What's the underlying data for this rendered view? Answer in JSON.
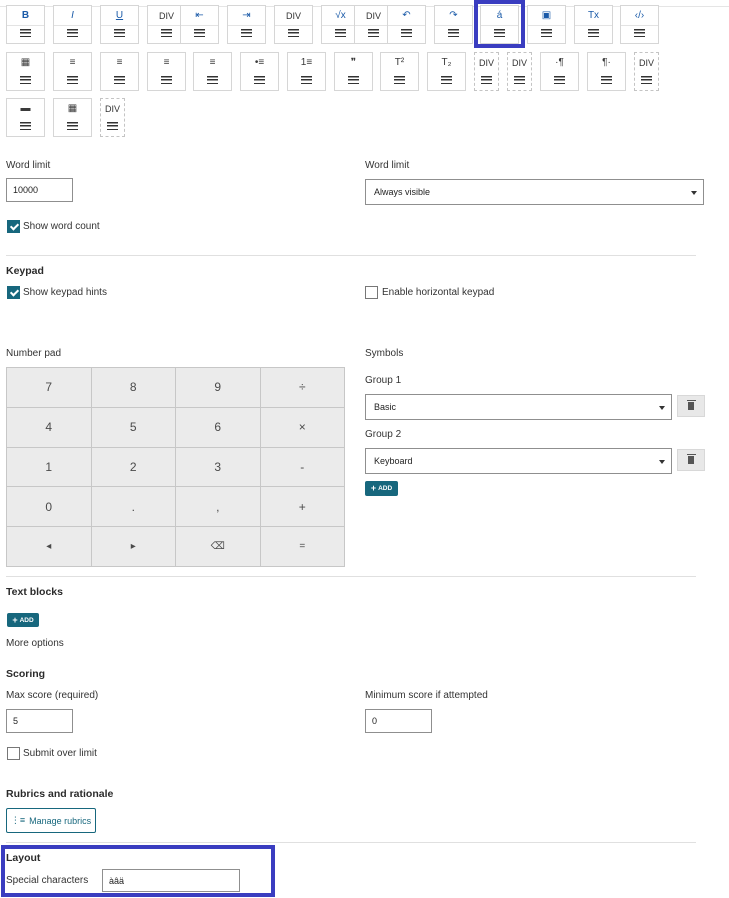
{
  "toolbar": {
    "row1": [
      {
        "icon": "B",
        "name": "bold-icon",
        "type": "std"
      },
      {
        "icon": "I",
        "name": "italic-icon",
        "type": "std"
      },
      {
        "icon": "U",
        "name": "underline-icon",
        "type": "std"
      },
      {
        "icon": "DIV",
        "name": "div-icon",
        "type": "std"
      },
      {
        "icon": "⇤",
        "name": "outdent-icon",
        "type": "std"
      },
      {
        "icon": "⇥",
        "name": "indent-icon",
        "type": "std"
      },
      {
        "icon": "DIV",
        "name": "div-icon",
        "type": "std"
      },
      {
        "icon": "√x",
        "name": "math-icon",
        "type": "std"
      },
      {
        "icon": "DIV",
        "name": "div-icon",
        "type": "std"
      },
      {
        "icon": "↶",
        "name": "undo-icon",
        "type": "std"
      },
      {
        "icon": "↷",
        "name": "redo-icon",
        "type": "std"
      },
      {
        "icon": "á",
        "name": "special-characters-icon",
        "type": "std"
      },
      {
        "icon": "▣",
        "name": "image-icon",
        "type": "std"
      },
      {
        "icon": "Tx",
        "name": "clear-format-icon",
        "type": "std"
      },
      {
        "icon": "‹/›",
        "name": "source-code-icon",
        "type": "std"
      }
    ],
    "row2": [
      {
        "icon": "▦",
        "name": "calendar-icon",
        "type": "plain"
      },
      {
        "icon": "≡",
        "name": "align-left-icon",
        "type": "plain"
      },
      {
        "icon": "≡",
        "name": "align-center-icon",
        "type": "plain"
      },
      {
        "icon": "≡",
        "name": "align-right-icon",
        "type": "plain"
      },
      {
        "icon": "≡",
        "name": "justify-icon",
        "type": "plain"
      },
      {
        "icon": "•≡",
        "name": "bulleted-list-icon",
        "type": "plain"
      },
      {
        "icon": "1≡",
        "name": "numbered-list-icon",
        "type": "plain"
      },
      {
        "icon": "❞",
        "name": "blockquote-icon",
        "type": "plain"
      },
      {
        "icon": "T²",
        "name": "superscript-icon",
        "type": "plain"
      },
      {
        "icon": "T₂",
        "name": "subscript-icon",
        "type": "plain"
      },
      {
        "icon": "DIV",
        "name": "div-icon",
        "type": "dashed"
      },
      {
        "icon": "DIV",
        "name": "div-icon",
        "type": "dashed"
      },
      {
        "icon": "·¶",
        "name": "ltr-paragraph-icon",
        "type": "plain"
      },
      {
        "icon": "¶·",
        "name": "rtl-paragraph-icon",
        "type": "plain"
      },
      {
        "icon": "DIV",
        "name": "div-icon",
        "type": "dashed"
      }
    ],
    "row3": [
      {
        "icon": "▬",
        "name": "horizontal-rule-icon",
        "type": "plain"
      },
      {
        "icon": "▦",
        "name": "table-icon",
        "type": "plain"
      },
      {
        "icon": "DIV",
        "name": "div-icon",
        "type": "dashed"
      }
    ]
  },
  "word_limit": {
    "label": "Word limit",
    "value": "10000",
    "mode_label": "Word limit",
    "mode_value": "Always visible",
    "show_count_label": "Show word count"
  },
  "keypad": {
    "heading": "Keypad",
    "show_hints_label": "Show keypad hints",
    "horizontal_label": "Enable horizontal keypad",
    "number_pad_label": "Number pad",
    "keys": [
      "7",
      "8",
      "9",
      "÷",
      "4",
      "5",
      "6",
      "×",
      "1",
      "2",
      "3",
      "-",
      "0",
      ".",
      ",",
      "+",
      "◂",
      "▸",
      "⌫",
      "="
    ],
    "symbols_label": "Symbols",
    "group1_label": "Group 1",
    "group1_value": "Basic",
    "group2_label": "Group 2",
    "group2_value": "Keyboard",
    "add_label": "ADD"
  },
  "text_blocks": {
    "heading": "Text blocks",
    "add_label": "ADD"
  },
  "more_options": "More options",
  "scoring": {
    "heading": "Scoring",
    "max_label": "Max score (required)",
    "max_value": "5",
    "min_label": "Minimum score if attempted",
    "min_value": "0",
    "submit_over_label": "Submit over limit"
  },
  "rubrics": {
    "heading": "Rubrics and rationale",
    "button_label": "Manage rubrics"
  },
  "layout": {
    "heading": "Layout",
    "special_label": "Special characters",
    "special_value": "àâä"
  },
  "colors": {
    "accent": "#17677d",
    "highlight": "#3a3dc0"
  }
}
